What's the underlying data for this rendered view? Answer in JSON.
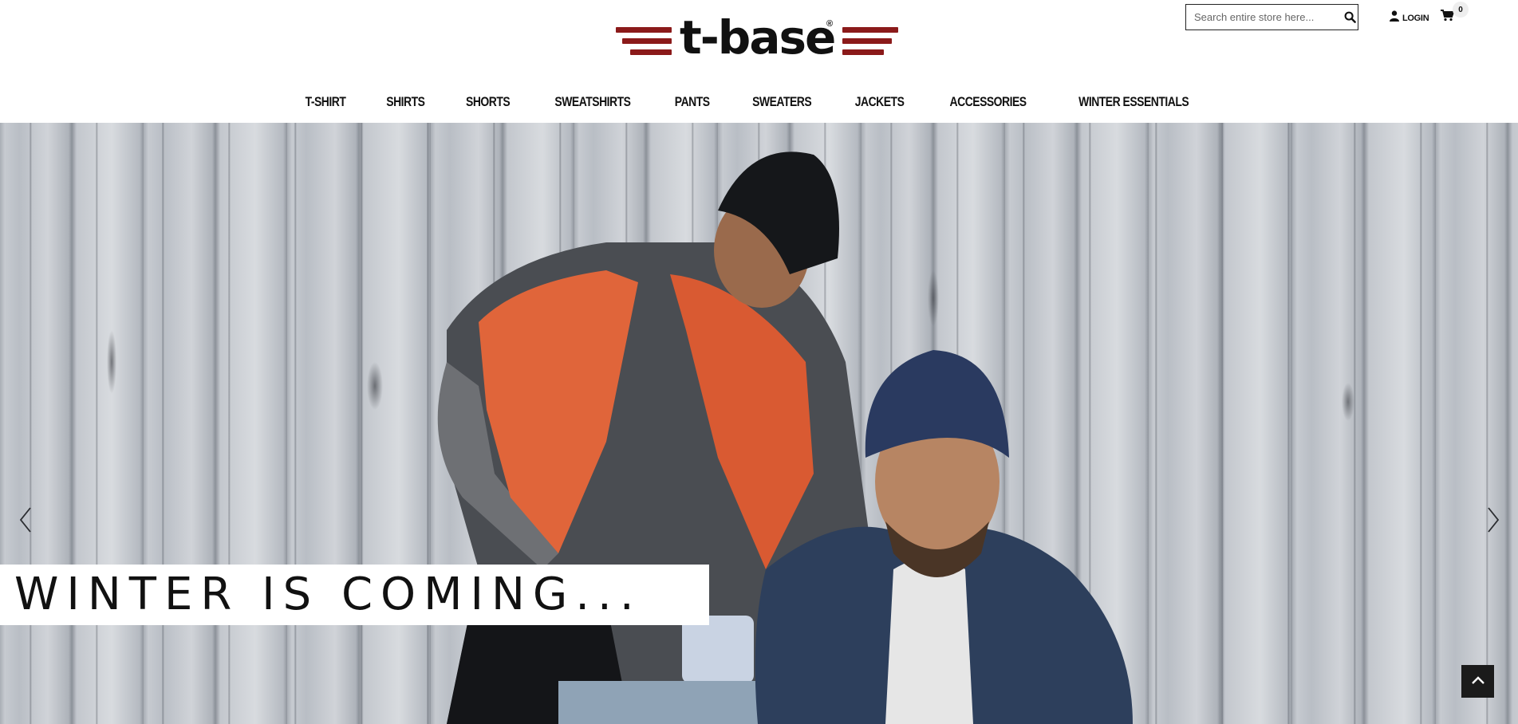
{
  "brand": {
    "logo_text": "t-base",
    "registered_mark": "®",
    "accent_color": "#8b1a1a"
  },
  "header": {
    "search": {
      "placeholder": "Search entire store here...",
      "value": "",
      "icon": "search-icon"
    },
    "login": {
      "label": "LOGIN",
      "icon": "user-icon"
    },
    "cart": {
      "count": "0",
      "icon": "shopping-cart-icon"
    }
  },
  "nav": {
    "items": [
      {
        "label": "T-SHIRT"
      },
      {
        "label": "SHIRTS"
      },
      {
        "label": "SHORTS"
      },
      {
        "label": "SWEATSHIRTS"
      },
      {
        "label": "PANTS"
      },
      {
        "label": "SWEATERS"
      },
      {
        "label": "JACKETS"
      },
      {
        "label": "ACCESSORIES"
      },
      {
        "label": "WINTER ESSENTIALS"
      }
    ]
  },
  "hero": {
    "tagline": "WINTER IS COMING...",
    "prev_icon": "chevron-left-icon",
    "next_icon": "chevron-right-icon"
  },
  "back_to_top": {
    "icon": "chevron-up-icon"
  }
}
